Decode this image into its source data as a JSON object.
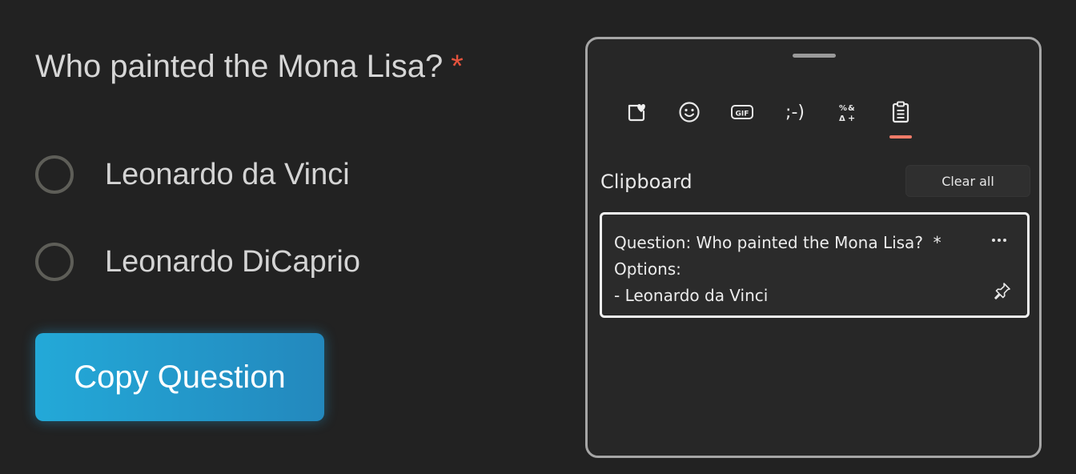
{
  "form": {
    "question": "Who painted the Mona Lisa?",
    "required_marker": "*",
    "options": [
      {
        "label": "Leonardo da Vinci"
      },
      {
        "label": "Leonardo DiCaprio"
      }
    ],
    "copy_button_label": "Copy Question"
  },
  "clipboard_panel": {
    "tabs": [
      {
        "icon": "sticker-heart-icon"
      },
      {
        "icon": "emoji-icon"
      },
      {
        "icon": "gif-icon",
        "text": "GIF"
      },
      {
        "icon": "kaomoji-icon",
        "text": ";-)"
      },
      {
        "icon": "symbols-icon"
      },
      {
        "icon": "clipboard-icon",
        "active": true
      }
    ],
    "title": "Clipboard",
    "clear_all_label": "Clear all",
    "items": [
      {
        "text": "Question: Who painted the Mona Lisa?  *\nOptions:\n- Leonardo da Vinci",
        "more_icon": "ellipsis-icon",
        "pin_icon": "pin-icon"
      }
    ]
  },
  "colors": {
    "background": "#222222",
    "required": "#e5533d",
    "button_accent": "#23a9d8",
    "active_tab_indicator": "#f07b68",
    "panel_border": "#a6a6a6"
  }
}
